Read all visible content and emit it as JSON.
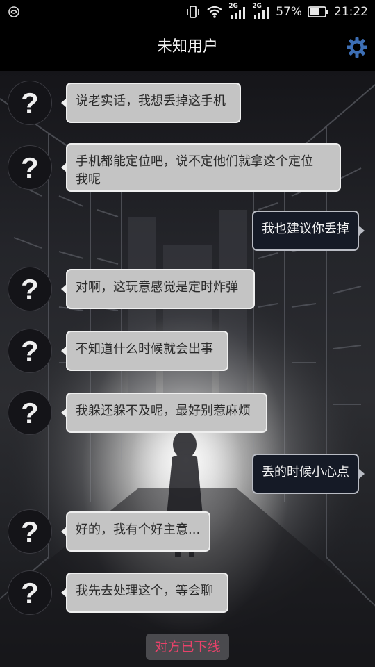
{
  "status_bar": {
    "network_1": "2G",
    "network_2": "2G",
    "battery": "57%",
    "time": "21:22"
  },
  "header": {
    "title": "未知用户"
  },
  "messages": [
    {
      "side": "in",
      "avatar": "?",
      "text": "说老实话，我想丢掉这手机"
    },
    {
      "side": "in",
      "avatar": "?",
      "text": "手机都能定位吧，说不定他们就拿这个定位\n我呢"
    },
    {
      "side": "out",
      "text": "我也建议你丢掉"
    },
    {
      "side": "in",
      "avatar": "?",
      "text": "对啊，这玩意感觉是定时炸弹"
    },
    {
      "side": "in",
      "avatar": "?",
      "text": "不知道什么时候就会出事"
    },
    {
      "side": "in",
      "avatar": "?",
      "text": "我躲还躲不及呢，最好别惹麻烦"
    },
    {
      "side": "out",
      "text": "丢的时候小心点"
    },
    {
      "side": "in",
      "avatar": "?",
      "text": "好的，我有个好主意..."
    },
    {
      "side": "in",
      "avatar": "?",
      "text": "我先去处理这个，等会聊"
    }
  ],
  "footer": {
    "status": "对方已下线"
  },
  "colors": {
    "incoming_bubble": "#c4c4c4",
    "outgoing_bubble": "#151a26",
    "offline_text": "#e8426a",
    "settings_icon": "#3d6fb6"
  },
  "icons": {
    "settings": "gear-icon",
    "avatar": "question-mark-icon"
  }
}
